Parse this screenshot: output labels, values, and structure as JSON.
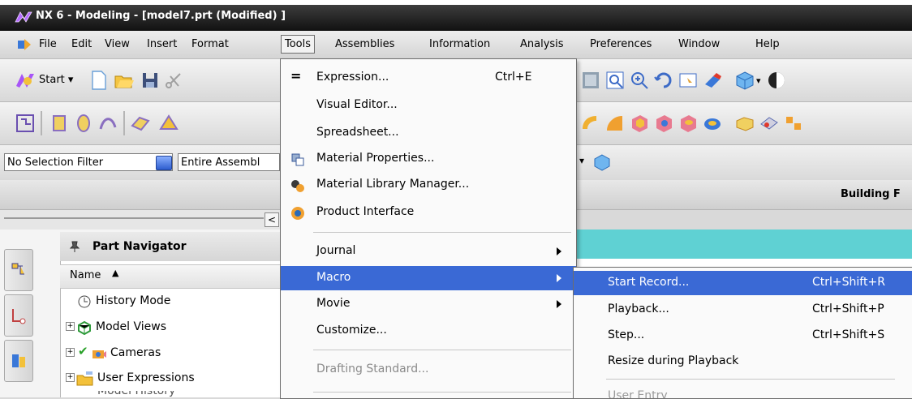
{
  "window": {
    "title": "NX 6 - Modeling - [model7.prt (Modified) ]"
  },
  "menubar": {
    "items": [
      {
        "label": "File",
        "u": "F"
      },
      {
        "label": "Edit",
        "u": ""
      },
      {
        "label": "View",
        "u": "V"
      },
      {
        "label": "Insert",
        "u": "s"
      },
      {
        "label": "Format",
        "u": "m"
      },
      {
        "label": "Tools",
        "u": ""
      },
      {
        "label": "Assemblies",
        "u": "A"
      },
      {
        "label": "Information",
        "u": "I"
      },
      {
        "label": "Analysis",
        "u": "l"
      },
      {
        "label": "Preferences",
        "u": "P"
      },
      {
        "label": "Window",
        "u": "o"
      },
      {
        "label": "Help",
        "u": "H"
      }
    ]
  },
  "toolbar": {
    "start_label": "Start"
  },
  "filters": {
    "selection_filter": "No Selection Filter",
    "scope": "Entire Assembl"
  },
  "ribbon": {
    "right_label": "Building F"
  },
  "navigator": {
    "title": "Part Navigator",
    "column_name": "Name",
    "rows": [
      {
        "label": "History Mode",
        "icon": "clock-icon"
      },
      {
        "label": "Model Views",
        "icon": "views-icon"
      },
      {
        "label": "Cameras",
        "icon": "camera-icon"
      },
      {
        "label": "User Expressions",
        "icon": "folder-icon"
      },
      {
        "label": "Model History",
        "icon": "folder-icon"
      }
    ]
  },
  "tools_menu": {
    "items": [
      {
        "label": "Expression...",
        "shortcut": "Ctrl+E",
        "icon": "equals-icon"
      },
      {
        "label": "Visual Editor...",
        "shortcut": ""
      },
      {
        "label": "Spreadsheet...",
        "shortcut": ""
      },
      {
        "label": "Material Properties...",
        "shortcut": "",
        "icon": "material-properties-icon"
      },
      {
        "label": "Material Library Manager...",
        "shortcut": "",
        "icon": "material-library-icon"
      },
      {
        "label": "Product Interface",
        "shortcut": "",
        "icon": "product-interface-icon"
      },
      {
        "label": "Journal",
        "submenu": true
      },
      {
        "label": "Macro",
        "submenu": true,
        "highlighted": true
      },
      {
        "label": "Movie",
        "submenu": true
      },
      {
        "label": "Customize...",
        "shortcut": ""
      },
      {
        "label": "Drafting Standard...",
        "disabled": true
      }
    ]
  },
  "macro_submenu": {
    "items": [
      {
        "label": "Start Record...",
        "shortcut": "Ctrl+Shift+R",
        "highlighted": true
      },
      {
        "label": "Playback...",
        "shortcut": "Ctrl+Shift+P"
      },
      {
        "label": "Step...",
        "shortcut": "Ctrl+Shift+S"
      },
      {
        "label": "Resize during Playback",
        "shortcut": ""
      },
      {
        "label": "User Entry",
        "shortcut": "",
        "disabled": true
      }
    ]
  },
  "colors": {
    "highlight": "#3a69d5",
    "graphics_area": "#5fd1d3",
    "titlebar": "#2a2a2a"
  }
}
